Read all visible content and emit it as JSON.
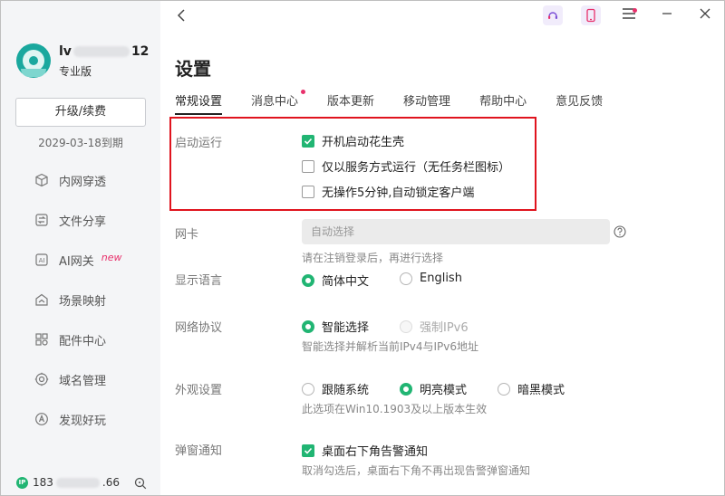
{
  "sidebar": {
    "user_name_prefix": "lv",
    "user_name_suffix": "12",
    "plan": "专业版",
    "upgrade_label": "升级/续费",
    "expire": "2029-03-18到期",
    "items": [
      {
        "label": "内网穿透",
        "icon": "cube-icon"
      },
      {
        "label": "文件分享",
        "icon": "file-share-icon"
      },
      {
        "label": "AI网关",
        "icon": "ai-icon",
        "badge": "new"
      },
      {
        "label": "场景映射",
        "icon": "scene-icon"
      },
      {
        "label": "配件中心",
        "icon": "accessory-icon"
      },
      {
        "label": "域名管理",
        "icon": "domain-icon"
      },
      {
        "label": "发现好玩",
        "icon": "discover-icon"
      }
    ],
    "ip_badge": "IP",
    "ip_prefix": "183",
    "ip_suffix": ".66"
  },
  "page": {
    "title": "设置",
    "tabs": [
      {
        "label": "常规设置",
        "active": true
      },
      {
        "label": "消息中心",
        "dot": true
      },
      {
        "label": "版本更新"
      },
      {
        "label": "移动管理"
      },
      {
        "label": "帮助中心"
      },
      {
        "label": "意见反馈"
      }
    ]
  },
  "settings": {
    "startup": {
      "label": "启动运行",
      "options": [
        {
          "label": "开机启动花生壳",
          "checked": true
        },
        {
          "label": "仅以服务方式运行（无任务栏图标）",
          "checked": false
        },
        {
          "label": "无操作5分钟,自动锁定客户端",
          "checked": false
        }
      ]
    },
    "nic": {
      "label": "网卡",
      "placeholder": "自动选择",
      "hint": "请在注销登录后，再进行选择"
    },
    "language": {
      "label": "显示语言",
      "options": [
        {
          "label": "简体中文",
          "selected": true
        },
        {
          "label": "English",
          "selected": false
        }
      ]
    },
    "protocol": {
      "label": "网络协议",
      "options": [
        {
          "label": "智能选择",
          "selected": true
        },
        {
          "label": "强制IPv6",
          "selected": false,
          "disabled": true
        }
      ],
      "hint": "智能选择并解析当前IPv4与IPv6地址"
    },
    "appearance": {
      "label": "外观设置",
      "options": [
        {
          "label": "跟随系统",
          "selected": false
        },
        {
          "label": "明亮模式",
          "selected": true
        },
        {
          "label": "暗黑模式",
          "selected": false
        }
      ],
      "hint": "此选项在Win10.1903及以上版本生效"
    },
    "popup": {
      "label": "弹窗通知",
      "option": {
        "label": "桌面右下角告警通知",
        "checked": true
      },
      "hint": "取消勾选后，桌面右下角不再出现告警弹窗通知"
    }
  },
  "colors": {
    "accent": "#21b573",
    "highlight": "#e0141e",
    "badge": "#e8306b"
  }
}
